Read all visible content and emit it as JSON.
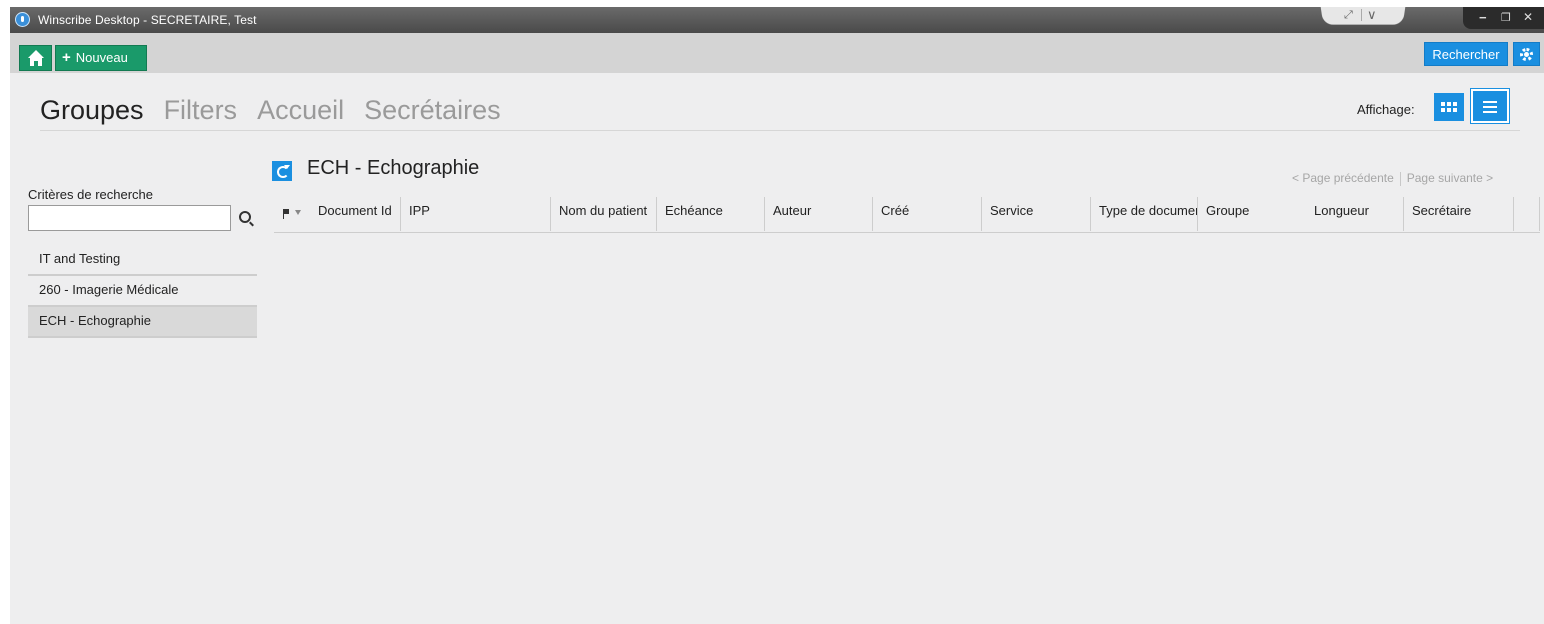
{
  "window": {
    "title": "Winscribe Desktop - SECRETAIRE, Test",
    "min_label": "−",
    "restore_label": "❐",
    "close_label": "✕",
    "expand_label": "⤢",
    "chevron_label": "∨"
  },
  "toolbar": {
    "new_label": "Nouveau",
    "new_plus": "+",
    "search_label": "Rechercher"
  },
  "nav": {
    "tabs": [
      {
        "label": "Groupes",
        "active": true
      },
      {
        "label": "Filters",
        "active": false
      },
      {
        "label": "Accueil",
        "active": false
      },
      {
        "label": "Secrétaires",
        "active": false
      }
    ]
  },
  "view": {
    "label": "Affichage:"
  },
  "search_panel": {
    "criteria_label": "Critères de recherche",
    "input_value": "",
    "groups": [
      {
        "label": "IT and Testing",
        "selected": false
      },
      {
        "label": "260 - Imagerie Médicale",
        "selected": false
      },
      {
        "label": "ECH - Echographie",
        "selected": true
      }
    ]
  },
  "main": {
    "group_title": "ECH - Echographie",
    "pager": {
      "previous_label": "< Page précédente",
      "next_label": "Page suivante >"
    },
    "columns": [
      "Document Id",
      "IPP",
      "Nom du patient",
      "Echéance",
      "Auteur",
      "Créé",
      "Service",
      "Type de document",
      "Groupe",
      "Longueur",
      "Secrétaire"
    ],
    "rows": []
  },
  "colors": {
    "green_button": "#1a9a6a",
    "blue_accent": "#1a8fe0",
    "title_bar": "#4a4a4a",
    "toolbar": "#d4d4d4",
    "content_bg": "#eeeeef"
  }
}
